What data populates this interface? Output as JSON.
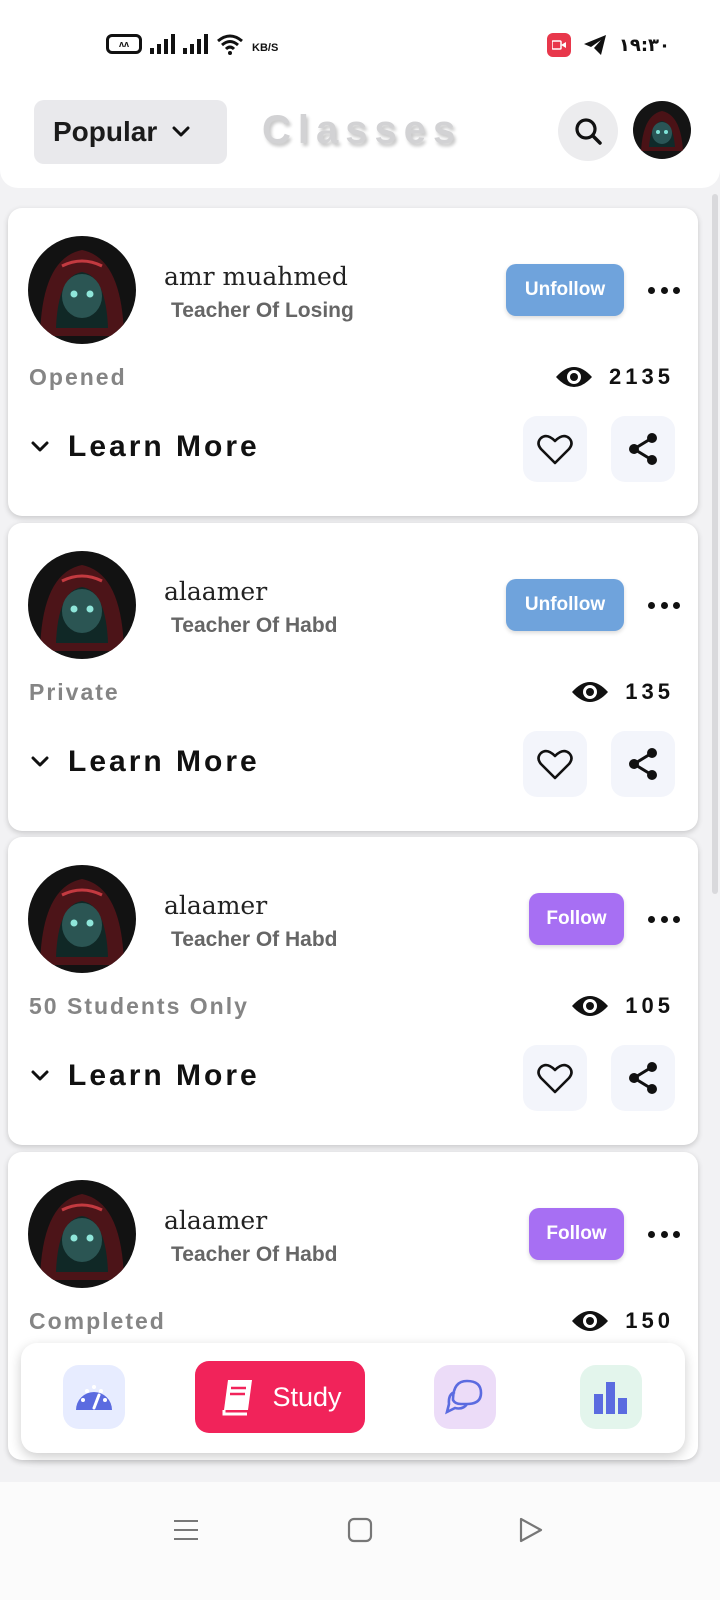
{
  "status_bar": {
    "net_speed": "KB/S",
    "time": "١٩:٣٠",
    "icons": [
      "vibrate-icon",
      "signal-icon",
      "signal-icon",
      "wifi-icon",
      "screen-record-icon",
      "telegram-icon"
    ]
  },
  "header": {
    "sort_selected": "Popular",
    "title": "Classes",
    "icons": [
      "chevron-down-icon",
      "search-icon",
      "profile-avatar"
    ]
  },
  "cards": [
    {
      "name": "amr muahmed",
      "role": "Teacher Of Losing",
      "follow_label": "Unfollow",
      "status": "Opened",
      "views": "2135",
      "learn_more": "Learn More"
    },
    {
      "name": "alaamer",
      "role": "Teacher Of Habd",
      "follow_label": "Unfollow",
      "status": "Private",
      "views": "135",
      "learn_more": "Learn More"
    },
    {
      "name": "alaamer",
      "role": "Teacher Of Habd",
      "follow_label": "Follow",
      "status": "50 Students Only",
      "views": "105",
      "learn_more": "Learn More"
    },
    {
      "name": "alaamer",
      "role": "Teacher Of Habd",
      "follow_label": "Follow",
      "status": "Completed",
      "views": "150",
      "learn_more": ""
    }
  ],
  "bottom_nav": {
    "study_label": "Study",
    "tabs": [
      "dashboard-icon",
      "study-book-icon",
      "chat-icon",
      "stats-icon"
    ]
  },
  "colors": {
    "unfollow": "#6fa3dc",
    "follow": "#a76ff3",
    "study_active": "#f1235a",
    "title_muted": "#d2d2d4"
  }
}
